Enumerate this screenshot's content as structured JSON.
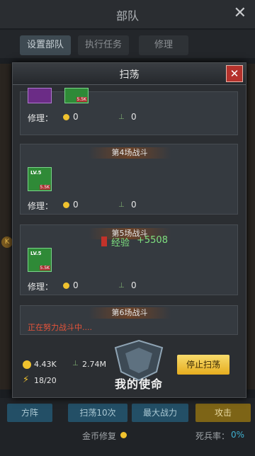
{
  "window": {
    "title": "部队"
  },
  "tabs": [
    {
      "label": "设置部队",
      "active": true
    },
    {
      "label": "执行任务",
      "active": false
    },
    {
      "label": "修理",
      "active": false
    }
  ],
  "modal": {
    "title": "扫荡",
    "repair_label": "修理：",
    "battles": [
      {
        "label": "",
        "item_count": "5.5K",
        "coin": "0",
        "leaf": "0"
      },
      {
        "label": "第4场战斗",
        "item_level": "LV.5",
        "item_count": "5.5K",
        "coin": "0",
        "leaf": "0"
      },
      {
        "label": "第5场战斗",
        "item_level": "LV.5",
        "item_count": "5.5K",
        "coin": "0",
        "leaf": "0",
        "exp_label": "经验",
        "exp_value": "+5508"
      },
      {
        "label": "第6场战斗",
        "status": "正在努力战斗中...."
      }
    ],
    "summary": {
      "coins": "4.43K",
      "leaf": "2.74M",
      "energy": "18/20"
    },
    "stop_button": "停止扫荡",
    "logo_text": "我的使命"
  },
  "bottom": {
    "buttons": [
      "方阵",
      "扫荡10次",
      "最大战力",
      "攻击"
    ],
    "coin_repair": "金币修复",
    "casualty_label": "死兵率：",
    "casualty_value": "0%"
  },
  "side": {
    "badge": "K"
  },
  "colors": {
    "modal_bg": "#2b2e32",
    "close_red": "#b5322c",
    "stop_gold": "#e6ad1f",
    "exp_green": "#7fe07f"
  },
  "icons": {
    "coin": "coin-icon",
    "leaf": "leaf-icon",
    "energy": "lightning-icon",
    "close": "close-icon"
  }
}
